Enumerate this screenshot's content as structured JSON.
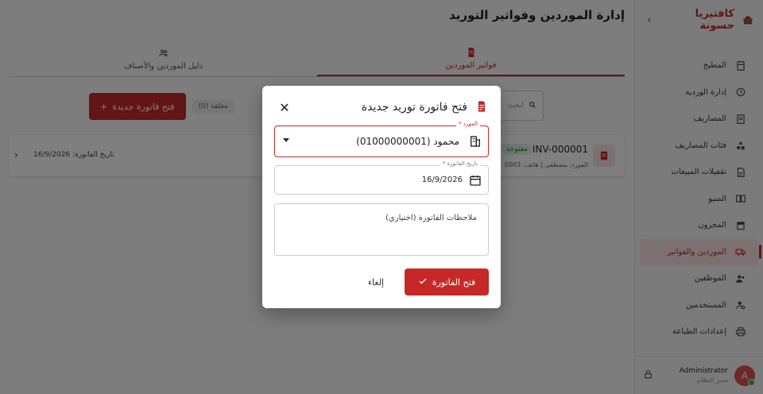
{
  "sidebar": {
    "brand": "كافتيريا حسونة",
    "items": [
      {
        "label": "المطبخ",
        "icon": "kitchen-icon"
      },
      {
        "label": "إدارة الوردية",
        "icon": "shift-icon"
      },
      {
        "label": "المصاريف",
        "icon": "expenses-icon"
      },
      {
        "label": "فئات المصاريف",
        "icon": "categories-icon"
      },
      {
        "label": "تقفيلات المبيعات",
        "icon": "sales-close-icon"
      },
      {
        "label": "المنيو",
        "icon": "menu-book-icon"
      },
      {
        "label": "المخزون",
        "icon": "inventory-icon"
      },
      {
        "label": "الموردين والفواتير",
        "icon": "truck-icon"
      },
      {
        "label": "الموظفين",
        "icon": "employees-icon"
      },
      {
        "label": "المستخدمين",
        "icon": "users-icon"
      },
      {
        "label": "إعدادات الطباعة",
        "icon": "printer-icon"
      }
    ],
    "user": {
      "name": "Administrator",
      "role": "مدير النظام",
      "initial": "A"
    }
  },
  "main": {
    "title": "إدارة الموردين وفواتير التوريد",
    "tabs": [
      {
        "label": "فواتير الموردين"
      },
      {
        "label": "دليل الموردين والأصناف"
      }
    ],
    "search_placeholder": "ابحث",
    "new_invoice": "فتح فاتورة جديدة",
    "filter_closed": "مغلقة (0)",
    "invoice": {
      "number": "INV-000001",
      "status": "مفتوحة",
      "meta": "المورد: مصطفى | هاتف: 0003",
      "date": "تاريخ الفاتورة: 16/9/2026"
    }
  },
  "dialog": {
    "title": "فتح فاتورة توريد جديدة",
    "supplier_label": "المورد *",
    "supplier_value": "محمود (01000000001)",
    "date_label": "تاريخ الفاتورة *",
    "date_value": "16/9/2026",
    "notes_placeholder": "ملاحظات الفاتورة (اختياري)",
    "cancel": "إلغاء",
    "submit": "فتح الفاتورة"
  },
  "colors": {
    "accent": "#c62828",
    "accent_light": "#fbe0e0"
  }
}
